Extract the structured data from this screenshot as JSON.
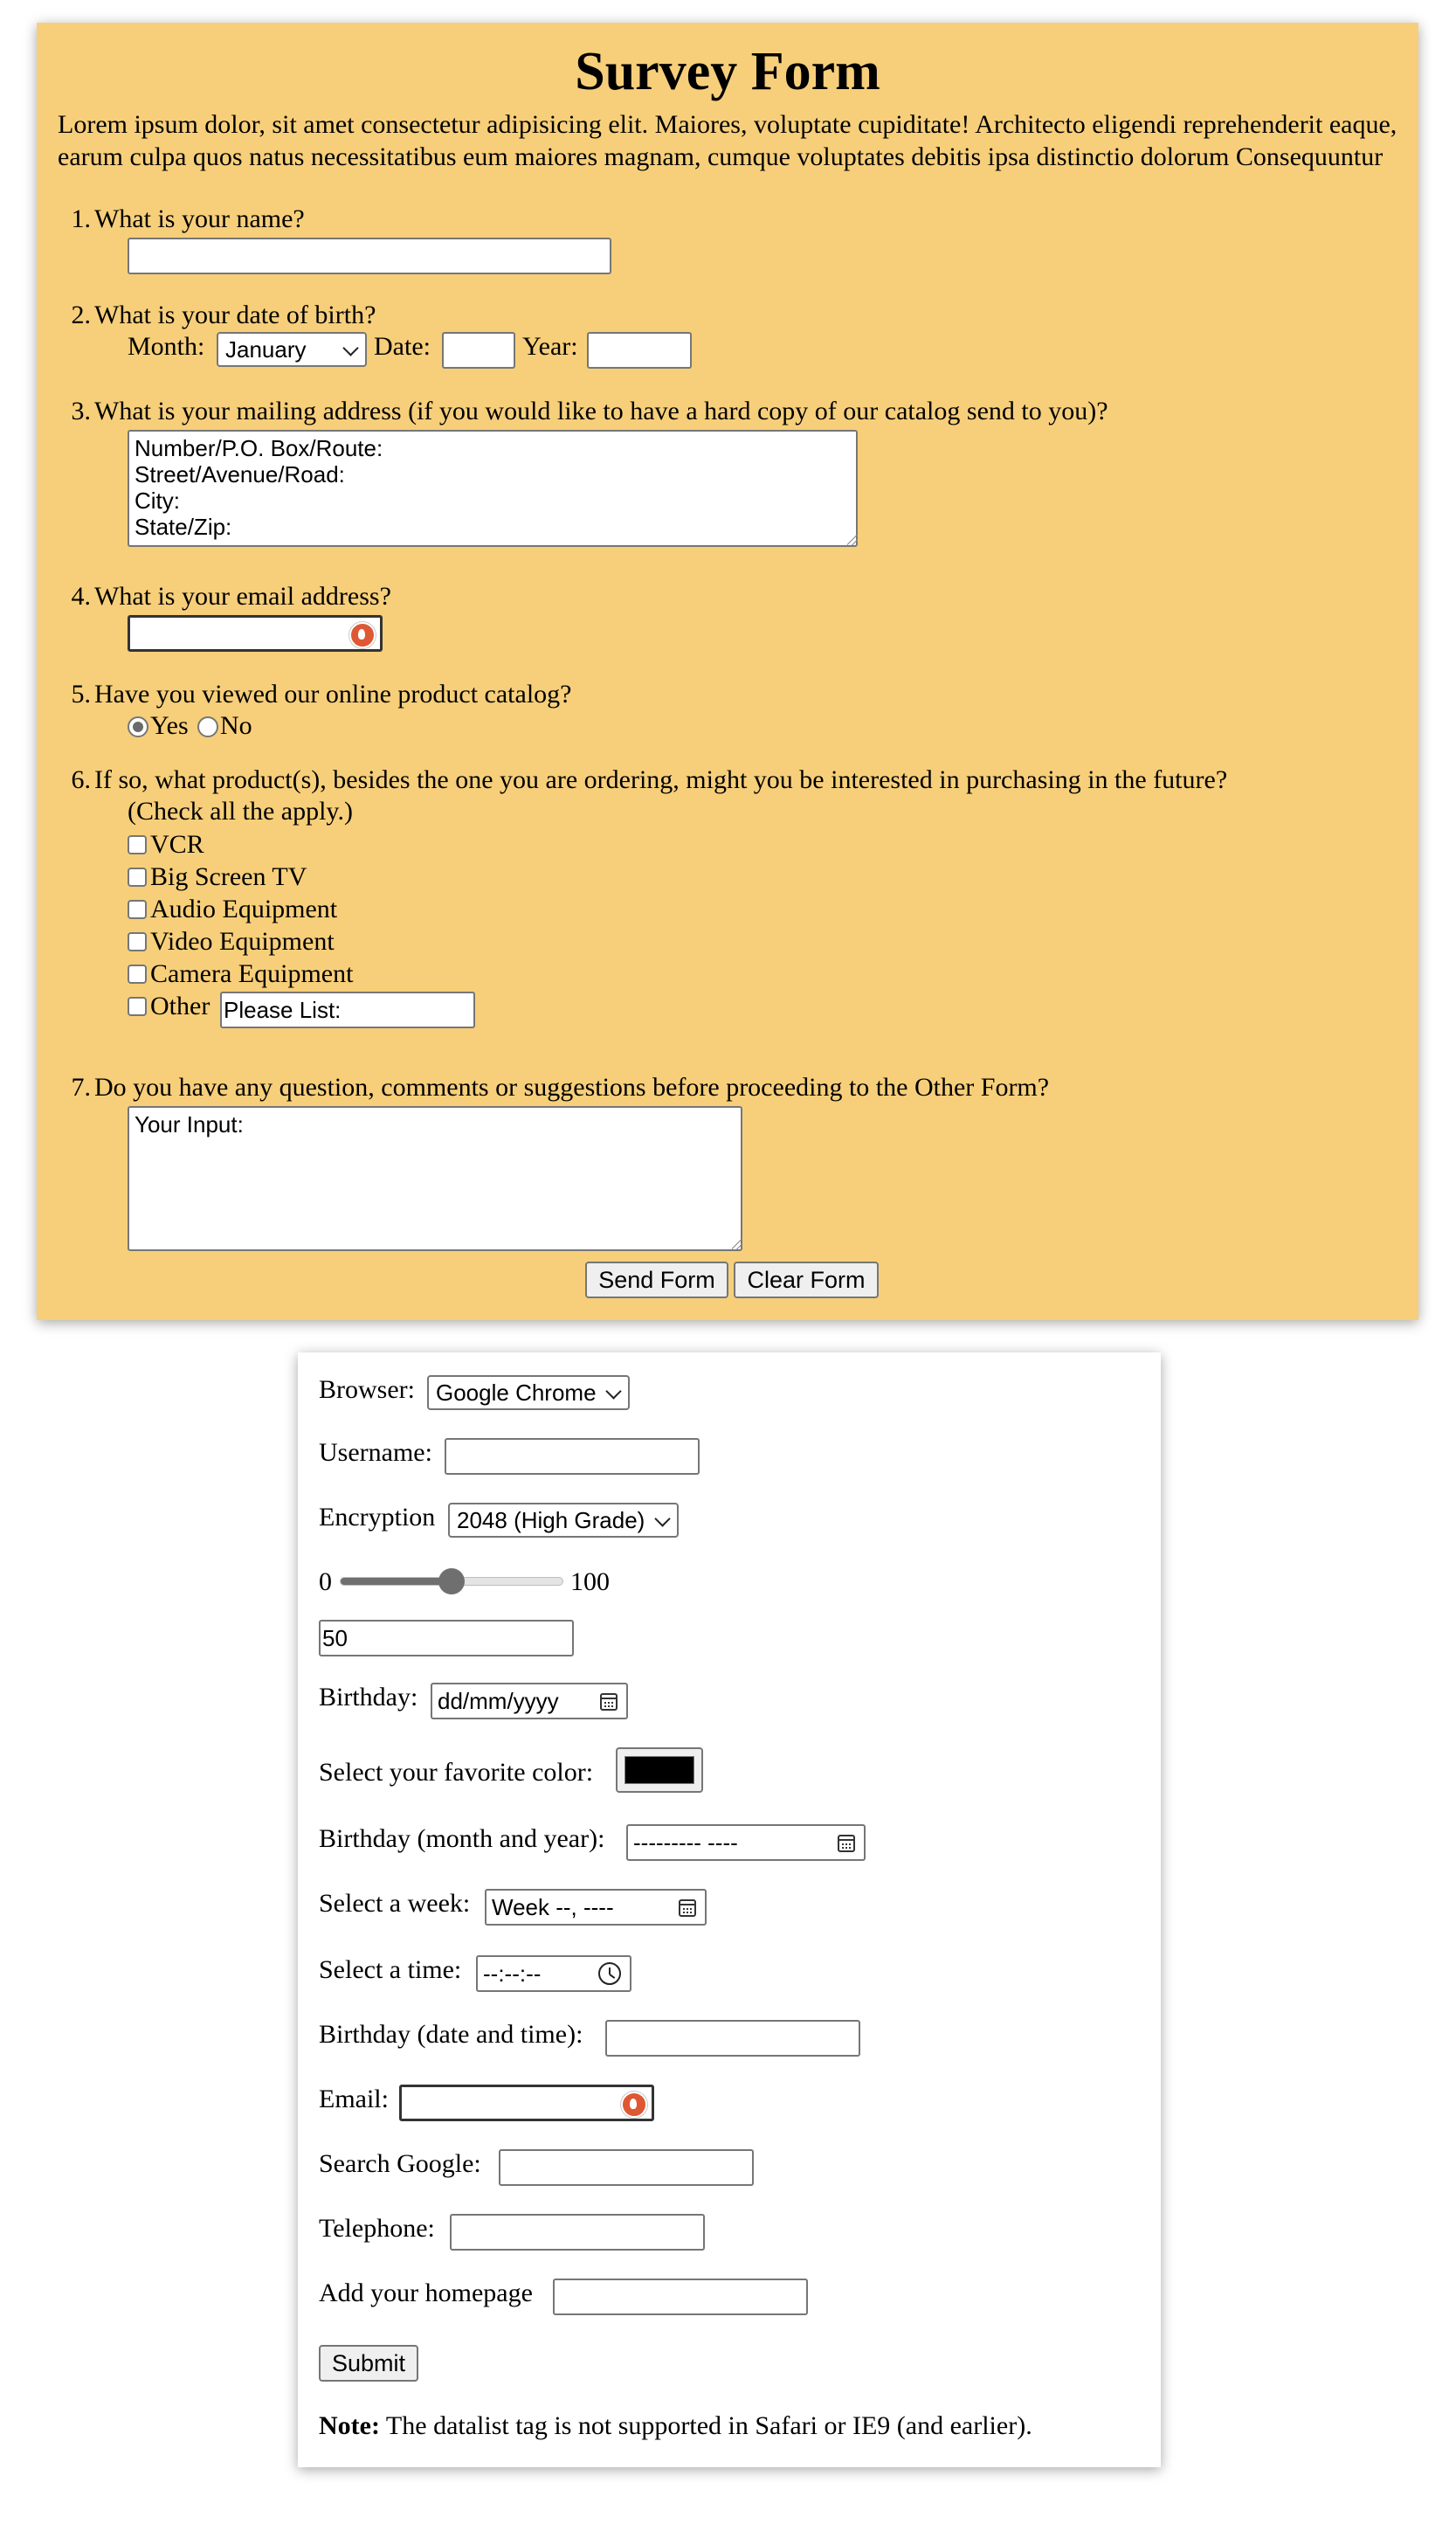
{
  "survey": {
    "title": "Survey Form",
    "intro": "Lorem ipsum dolor, sit amet consectetur adipisicing elit. Maiores, voluptate cupiditate! Architecto eligendi reprehenderit eaque, earum culpa quos natus necessitatibus eum maiores magnam, cumque voluptates debitis ipsa distinctio dolorum Consequuntur",
    "q1": {
      "num": "1.",
      "text": "What is your name?",
      "value": ""
    },
    "q2": {
      "num": "2.",
      "text": "What is your date of birth?",
      "month_label": "Month:",
      "month_value": "January",
      "date_label": "Date:",
      "year_label": "Year:"
    },
    "q3": {
      "num": "3.",
      "text": "What is your mailing address (if you would like to have a hard copy of our catalog send to you)?",
      "value": "Number/P.O. Box/Route:\nStreet/Avenue/Road:\nCity:\nState/Zip:"
    },
    "q4": {
      "num": "4.",
      "text": "What is your email address?"
    },
    "q5": {
      "num": "5.",
      "text": "Have you viewed our online product catalog?",
      "yes": "Yes",
      "no": "No"
    },
    "q6": {
      "num": "6.",
      "text": "If so, what product(s), besides the one you are ordering, might you be interested in purchasing in the future?",
      "text2": "(Check all the apply.)",
      "options": [
        "VCR",
        "Big Screen TV",
        "Audio Equipment",
        "Video Equipment",
        "Camera Equipment",
        "Other"
      ],
      "other_value": "Please List:"
    },
    "q7": {
      "num": "7.",
      "text": "Do you have any question, comments or suggestions before proceeding to the Other Form?",
      "value": "Your Input:"
    },
    "send_label": "Send Form",
    "clear_label": "Clear Form"
  },
  "form2": {
    "browser_label": "Browser:",
    "browser_value": "Google Chrome",
    "username_label": "Username:",
    "encryption_label": "Encryption",
    "encryption_value": "2048 (High Grade)",
    "range_min": "0",
    "range_max": "100",
    "range_value": 50,
    "range_output": "50",
    "birthday_label": "Birthday:",
    "birthday_placeholder": "dd/mm/yyyy",
    "color_label": "Select your favorite color:",
    "color_value": "#000000",
    "month_year_label": "Birthday (month and year):",
    "month_year_placeholder": "--------- ----",
    "week_label": "Select a week:",
    "week_placeholder": "Week --, ----",
    "time_label": "Select a time:",
    "time_placeholder": "--:--:--",
    "datetime_label": "Birthday (date and time):",
    "email_label": "Email:",
    "search_label": "Search Google:",
    "telephone_label": "Telephone:",
    "homepage_label": "Add your homepage",
    "submit_label": "Submit",
    "note_bold": "Note:",
    "note_text": " The datalist tag is not supported in Safari or IE9 (and earlier)."
  }
}
